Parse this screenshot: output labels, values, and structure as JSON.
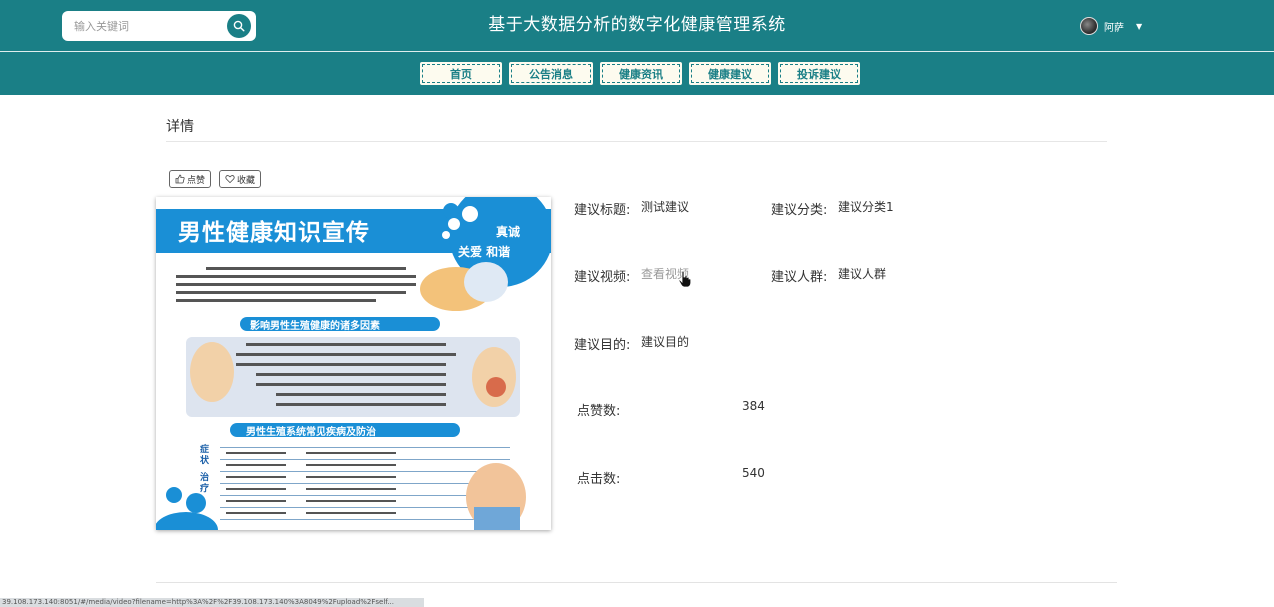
{
  "header": {
    "search_placeholder": "输入关键词",
    "site_title": "基于大数据分析的数字化健康管理系统",
    "username": "阿萨"
  },
  "nav": [
    {
      "label": "首页"
    },
    {
      "label": "公告消息"
    },
    {
      "label": "健康资讯"
    },
    {
      "label": "健康建议"
    },
    {
      "label": "投诉建议"
    }
  ],
  "page": {
    "breadcrumb": "详情",
    "like_label": "点赞",
    "favorite_label": "收藏"
  },
  "poster": {
    "title": "男性健康知识宣传",
    "badge_1": "真诚",
    "badge_2": "关爱 和谐",
    "section_1": "影响男性生殖健康的诸多因素",
    "section_2": "男性生殖系统常见疾病及防治",
    "side_1": "症状",
    "side_2": "治疗"
  },
  "details": {
    "title_label": "建议标题:",
    "title_value": "测试建议",
    "category_label": "建议分类:",
    "category_value": "建议分类1",
    "video_label": "建议视频:",
    "video_value": "查看视频",
    "crowd_label": "建议人群:",
    "crowd_value": "建议人群",
    "purpose_label": "建议目的:",
    "purpose_value": "建议目的",
    "likes_label": "点赞数:",
    "likes_value": "384",
    "clicks_label": "点击数:",
    "clicks_value": "540"
  },
  "status_url": "39.108.173.140:8051/#/media/video?filename=http%3A%2F%2F39.108.173.140%3A8049%2Fupload%2Fself..."
}
